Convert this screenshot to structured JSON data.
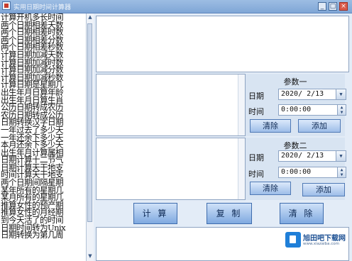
{
  "window": {
    "title": "实用日期时间计算器",
    "minimize_symbol": "_",
    "maximize_symbol": "□",
    "close_symbol": "×"
  },
  "functions": [
    "计算开机多长时间",
    "两个日期相差天数",
    "两个日期相差时数",
    "两个日期相差分数",
    "两个日期相差秒数",
    "计算日期加减天数",
    "计算日期加减时数",
    "计算日期加减分数",
    "计算日期加减秒数",
    "计算日期是星期几",
    "出生年月日算年龄",
    "出生年月日算生肖",
    "公历日期转成农历",
    "农历日期转成公历",
    "日期转换汉字日期",
    "一年过去了多少天",
    "一年还余下多少天",
    "本月还余下多少天",
    "出生年月计算属相",
    "日期计算十二节气",
    "日期计算天干地支",
    "时间计算天干地支",
    "两个日期间隔星期",
    "某年所有的星期几",
    "某月所有的星期几",
    "推算女性的预产期",
    "推算女性的月经期",
    "到今天活了的时间",
    "日期时间转为Unix",
    "日期转换为第几周"
  ],
  "param1": {
    "title": "参数一",
    "date_label": "日期",
    "date_value": "2020/ 2/13",
    "time_label": "时间",
    "time_value": "0:00:00",
    "clear_label": "清除",
    "add_label": "添加"
  },
  "param2": {
    "title": "参数二",
    "date_label": "日期",
    "date_value": "2020/ 2/13",
    "time_label": "时间",
    "time_value": "0:00:00",
    "clear_label": "清除",
    "add_label": "添加"
  },
  "actions": {
    "compute_label": "计 算",
    "copy_label": "复 制",
    "clear_label": "清 除"
  },
  "watermark": {
    "name": "旭田吧下载网",
    "url": "www.xiazaiba.com"
  },
  "icons": {
    "dropdown": "▼",
    "spin_up": "▲",
    "spin_down": "▼",
    "scroll_up": "▲",
    "scroll_down": "▼"
  },
  "colors": {
    "titlebar": "#8fb2df",
    "panel": "#d8e4f2",
    "button": "#9dbde8"
  }
}
